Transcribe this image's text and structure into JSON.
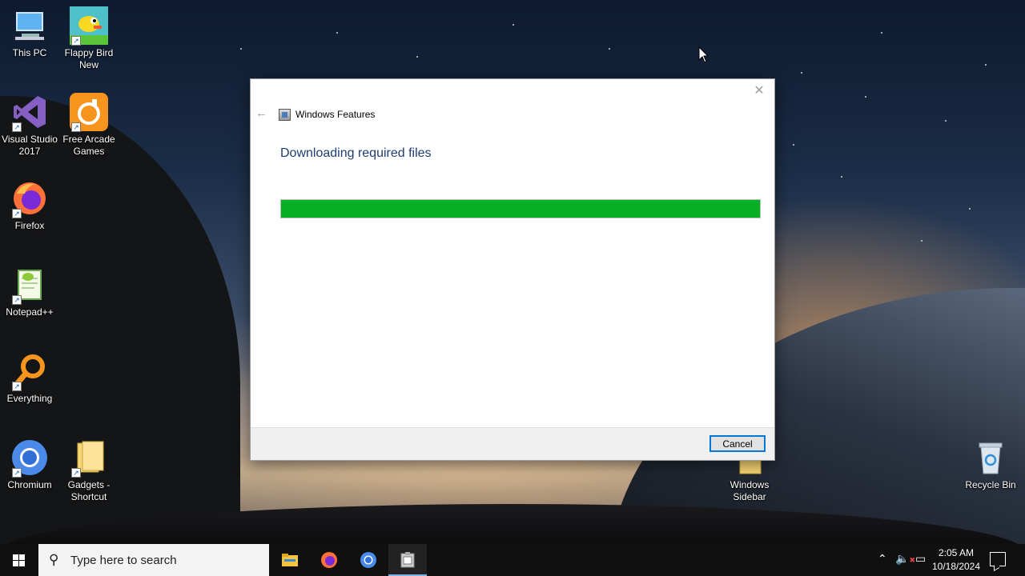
{
  "desktop": {
    "icons": [
      {
        "label": "This PC",
        "icon": "computer-icon"
      },
      {
        "label": "Flappy Bird New",
        "icon": "flappy-bird-icon"
      },
      {
        "label": "Visual Studio 2017",
        "icon": "visual-studio-icon"
      },
      {
        "label": "Free Arcade Games",
        "icon": "arcade-games-icon"
      },
      {
        "label": "Firefox",
        "icon": "firefox-icon"
      },
      {
        "label": "Notepad++",
        "icon": "notepad-plus-plus-icon"
      },
      {
        "label": "Everything",
        "icon": "everything-search-icon"
      },
      {
        "label": "Chromium",
        "icon": "chromium-icon"
      },
      {
        "label": "Gadgets - Shortcut",
        "icon": "folder-icon"
      },
      {
        "label": "Windows Sidebar",
        "icon": "folder-icon"
      },
      {
        "label": "Recycle Bin",
        "icon": "recycle-bin-icon"
      }
    ]
  },
  "dialog": {
    "title": "Windows Features",
    "heading": "Downloading required files",
    "progress_fraction": 1.0,
    "progress_color": "#06b025",
    "cancel_label": "Cancel",
    "close_glyph": "✕",
    "back_glyph": "←"
  },
  "taskbar": {
    "search_placeholder": "Type here to search",
    "apps": [
      "file-explorer-icon",
      "firefox-icon",
      "chromium-icon",
      "windows-features-icon"
    ],
    "time": "2:05 AM",
    "date": "10/18/2024"
  }
}
